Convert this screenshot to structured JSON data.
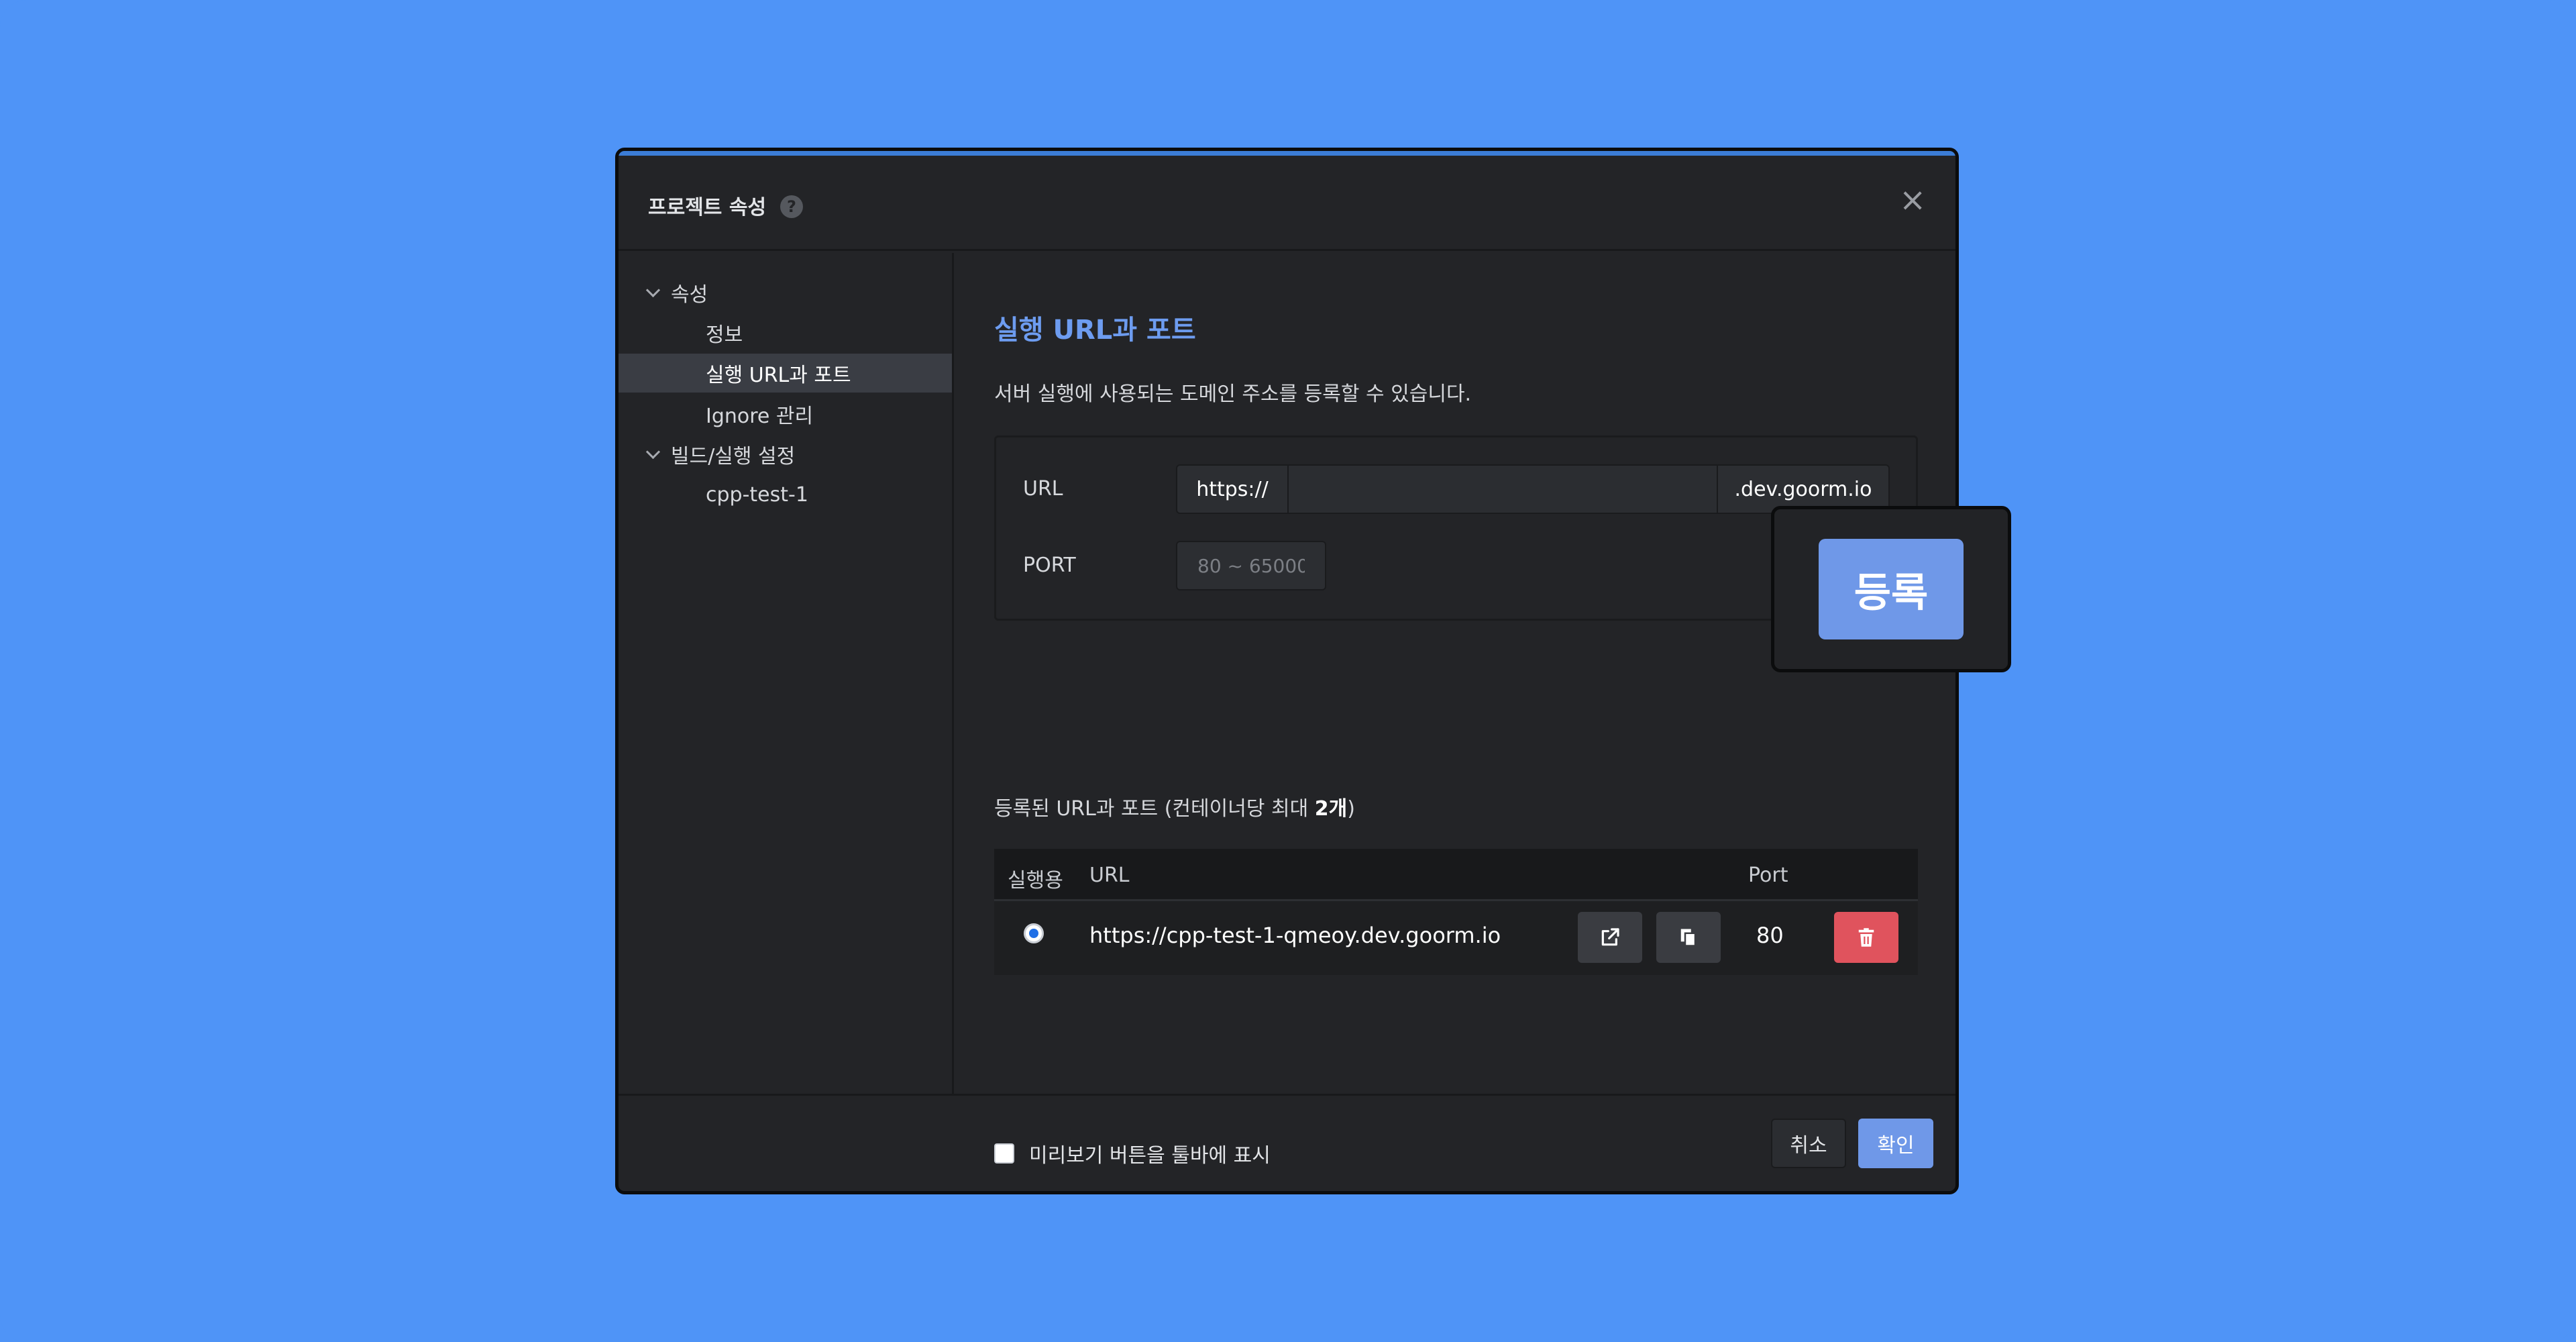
{
  "dialog": {
    "title": "프로젝트 속성",
    "help_icon": "?",
    "close_icon": "×"
  },
  "sidebar": {
    "groups": [
      {
        "label": "속성",
        "items": [
          "정보",
          "실행 URL과 포트",
          "Ignore 관리"
        ]
      },
      {
        "label": "빌드/실행 설정",
        "items": [
          "cpp-test-1"
        ]
      }
    ],
    "active_item": "실행 URL과 포트"
  },
  "main": {
    "section_title": "실행 URL과 포트",
    "description": "서버 실행에 사용되는 도메인 주소를 등록할 수 있습니다.",
    "form": {
      "url_label": "URL",
      "url_prefix": "https://",
      "url_value": "",
      "url_suffix": ".dev.goorm.io",
      "port_label": "PORT",
      "port_placeholder": "80 ~ 65000",
      "register_label": "등록"
    },
    "list_title": "등록된 URL과 포트 (컨테이너당 최대 ",
    "list_title_bold": "2개",
    "list_title_end": ")",
    "table": {
      "headers": {
        "run": "실행용",
        "url": "URL",
        "port": "Port"
      },
      "rows": [
        {
          "selected": true,
          "url": "https://cpp-test-1-qmeoy.dev.goorm.io",
          "port": "80"
        }
      ]
    },
    "preview_checkbox_label": "미리보기 버튼을 툴바에 표시",
    "preview_checked": false
  },
  "footer": {
    "cancel_label": "취소",
    "confirm_label": "확인"
  },
  "colors": {
    "background": "#4f94f7",
    "dialog": "#232427",
    "accent": "#6f98e8",
    "delete": "#e0535d",
    "title_blue": "#6d9cf0"
  },
  "icons": {
    "open": "external-link-icon",
    "copy": "copy-icon",
    "delete": "trash-icon"
  }
}
